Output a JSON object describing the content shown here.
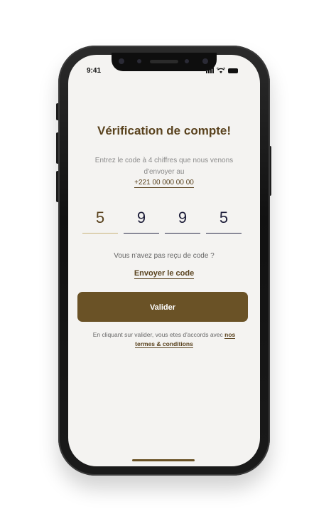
{
  "status_bar": {
    "time": "9:41"
  },
  "verification": {
    "title": "Vérification de compte!",
    "instruction": "Entrez le code à 4 chiffres que nous venons d'envoyer au",
    "phone_number": "+221 00 000 00 00",
    "code_digits": [
      "5",
      "9",
      "9",
      "5"
    ],
    "no_code_text": "Vous n'avez pas reçu de code ?",
    "resend_label": "Envoyer le code",
    "submit_label": "Valider",
    "terms_prefix": "En cliquant sur valider, vous etes d'accords avec",
    "terms_link": "nos termes & conditions"
  },
  "colors": {
    "brand": "#6a5226",
    "title": "#5a431f",
    "active_underline": "#c8b27a",
    "screen_bg": "#f4f3f1"
  },
  "icons": [
    "signal-icon",
    "wifi-icon",
    "battery-icon"
  ]
}
